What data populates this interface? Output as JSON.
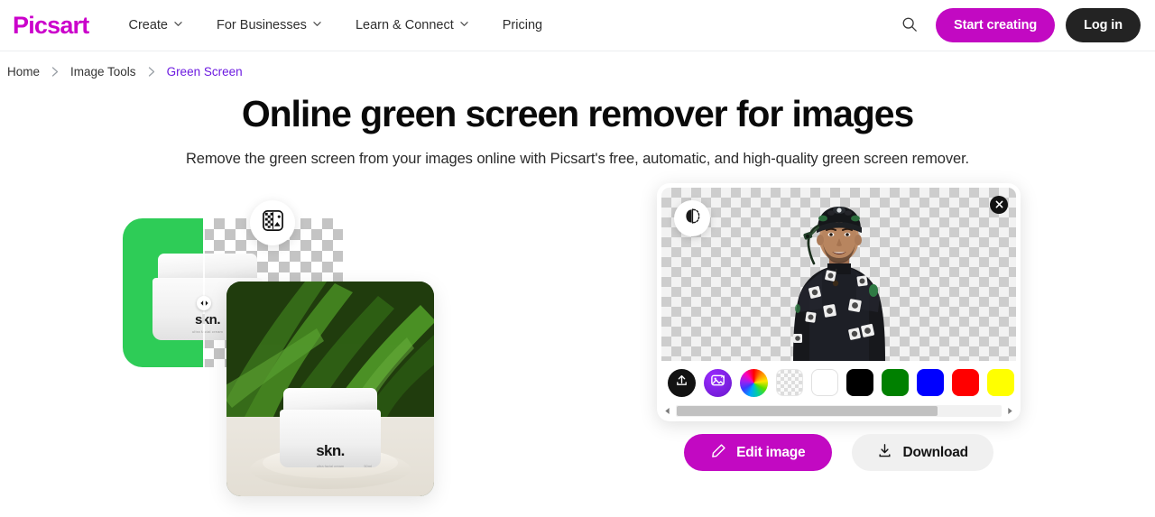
{
  "header": {
    "logo_text": "Picsart",
    "nav": [
      {
        "label": "Create",
        "has_dropdown": true
      },
      {
        "label": "For Businesses",
        "has_dropdown": true
      },
      {
        "label": "Learn & Connect",
        "has_dropdown": true
      },
      {
        "label": "Pricing",
        "has_dropdown": false
      }
    ],
    "search_icon": "search-icon",
    "start_creating_label": "Start creating",
    "login_label": "Log in",
    "start_creating_color": "#C209C2",
    "login_color": "#232323",
    "logo_color": "#CB00CB"
  },
  "breadcrumb": {
    "items": [
      {
        "label": "Home",
        "active": false
      },
      {
        "label": "Image Tools",
        "active": false
      },
      {
        "label": "Green Screen",
        "active": true
      }
    ],
    "separator": "chevron-right-icon",
    "active_color": "#6C1AE0"
  },
  "hero": {
    "title": "Online green screen remover for images",
    "subtitle": "Remove the green screen from your images online with Picsart's free, automatic, and high-quality green screen remover."
  },
  "illustration": {
    "green_color": "#2ECC57",
    "tool_badge_icon": "checkered-image-icon",
    "split_handle_icon": "drag-split-icon",
    "product_label": "skn.",
    "product_sublabel": "ultra facial cream",
    "product_volume": "50ml",
    "photo_label": "skn.",
    "photo_sublabel": "ultra facial cream"
  },
  "editor": {
    "compare_icon": "before-after-compare-icon",
    "close_icon": "close-icon",
    "canvas_subject": "person-in-motion-capture-suit",
    "background_transparent": true,
    "swatches": [
      {
        "name": "upload-background-button",
        "type": "icon",
        "icon": "upload-icon",
        "color": "#121212"
      },
      {
        "name": "ai-background-button",
        "type": "icon",
        "icon": "ai-image-icon",
        "color": "#7B1FE0"
      },
      {
        "name": "color-picker-button",
        "type": "icon",
        "icon": "color-wheel-icon",
        "color": "rainbow"
      },
      {
        "name": "transparent-swatch",
        "type": "swatch",
        "color": "transparent"
      },
      {
        "name": "white-swatch",
        "type": "swatch",
        "color": "#FFFFFF"
      },
      {
        "name": "black-swatch",
        "type": "swatch",
        "color": "#000000"
      },
      {
        "name": "green-swatch",
        "type": "swatch",
        "color": "#008000"
      },
      {
        "name": "blue-swatch",
        "type": "swatch",
        "color": "#0000FF"
      },
      {
        "name": "red-swatch",
        "type": "swatch",
        "color": "#FF0000"
      },
      {
        "name": "yellow-swatch",
        "type": "swatch",
        "color": "#FFFF00"
      },
      {
        "name": "orange-swatch",
        "type": "swatch",
        "color": "#FF9900"
      }
    ],
    "scrollbar": {
      "left_arrow": "chevron-left-icon",
      "right_arrow": "chevron-right-icon",
      "thumb_percent": 80
    }
  },
  "actions": {
    "edit_label": "Edit image",
    "edit_icon": "pencil-icon",
    "edit_color": "#C209C2",
    "download_label": "Download",
    "download_icon": "download-icon",
    "download_color": "#F0F0F0"
  }
}
